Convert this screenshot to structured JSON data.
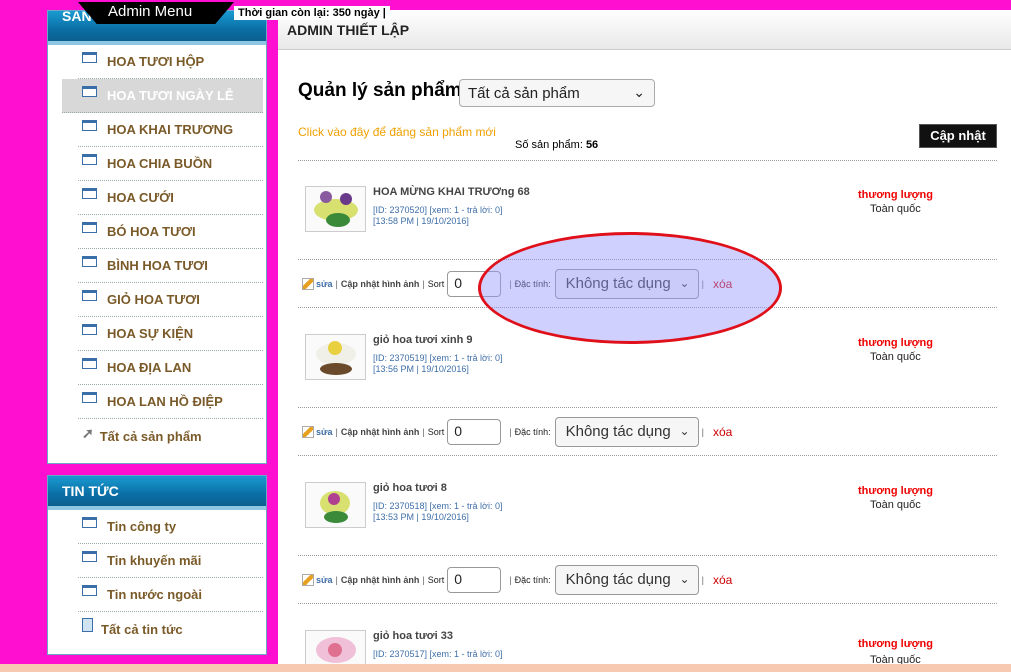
{
  "top": {
    "admin_menu": "Admin Menu",
    "time_left": "Thời gian còn lại: 350 ngày |"
  },
  "sidebar": {
    "products_title": "SẢN PHẨM",
    "products": [
      {
        "label": "HOA TƯƠI HỘP"
      },
      {
        "label": "HOA TƯƠI NGÀY LỄ"
      },
      {
        "label": "HOA KHAI TRƯƠNG"
      },
      {
        "label": "HOA CHIA BUỒN"
      },
      {
        "label": "HOA CƯỚI"
      },
      {
        "label": "BÓ HOA TƯƠI"
      },
      {
        "label": "BÌNH HOA TƯƠI"
      },
      {
        "label": "GIỎ HOA TƯƠI"
      },
      {
        "label": "HOA SỰ KIỆN"
      },
      {
        "label": "HOA ĐỊA LAN"
      },
      {
        "label": "HOA LAN HỒ ĐIỆP"
      },
      {
        "label": "Tất cả sản phẩm"
      }
    ],
    "news_title": "TIN TỨC",
    "news": [
      {
        "label": "Tin công ty"
      },
      {
        "label": "Tin khuyến mãi"
      },
      {
        "label": "Tin nước ngoài"
      },
      {
        "label": "Tất cả tin tức"
      }
    ]
  },
  "main": {
    "header": "ADMIN THIẾT LẬP",
    "title": "Quản lý sản phẩm",
    "filter_value": "Tất cả sản phẩm",
    "post_link": "Click vào đây để đăng sản phẩm mới",
    "count_label": "Số sản phẩm:",
    "count_value": "56",
    "update_button": "Cập nhật"
  },
  "products": [
    {
      "name": "HOA MỪNG KHAI TRƯƠng 68",
      "id_line": "[ID: 2370520] [xem: 1 - trả lời: 0]",
      "time_line": "[13:58 PM | 19/10/2016]",
      "price": "thương lượng",
      "region": "Toàn quốc",
      "sort": "0",
      "attr": "Không tác dụng"
    },
    {
      "name": "giỏ hoa tươi xinh 9",
      "id_line": "[ID: 2370519] [xem: 1 - trả lời: 0]",
      "time_line": "[13:56 PM | 19/10/2016]",
      "price": "thương lượng",
      "region": "Toàn quốc",
      "sort": "0",
      "attr": "Không tác dụng"
    },
    {
      "name": "giỏ hoa tươi 8",
      "id_line": "[ID: 2370518] [xem: 1 - trả lời: 0]",
      "time_line": "[13:53 PM | 19/10/2016]",
      "price": "thương lượng",
      "region": "Toàn quốc",
      "sort": "0",
      "attr": "Không tác dụng"
    },
    {
      "name": "giỏ hoa tươi 33",
      "id_line": "[ID: 2370517] [xem: 1 - trả lời: 0]",
      "time_line": "",
      "price": "thương lượng",
      "region": "Toàn quốc"
    }
  ],
  "actions": {
    "edit": "sửa",
    "update_image": "Cập nhật hình ảnh",
    "sort": "Sort",
    "attr_label": "Đặc tính:",
    "delete": "xóa"
  },
  "colors": {
    "page_bg": "#ff10d0",
    "accent_blue": "#0a6fa6",
    "price_red": "#e00000",
    "link_orange": "#f0a000"
  }
}
